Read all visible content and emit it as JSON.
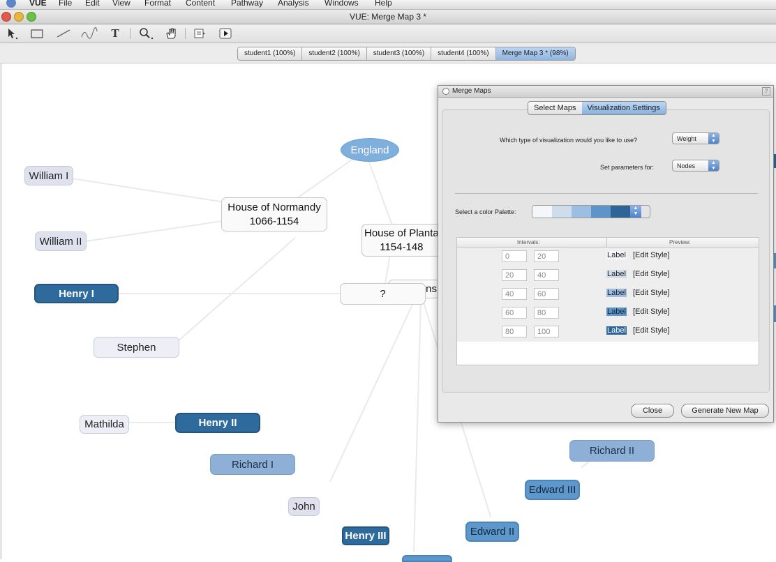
{
  "menubar": {
    "app": "VUE",
    "items": [
      "File",
      "Edit",
      "View",
      "Format",
      "Content",
      "Pathway",
      "Analysis",
      "Windows",
      "Help"
    ]
  },
  "window": {
    "title": "VUE: Merge Map 3 *"
  },
  "toolbar": {
    "tools": [
      "select-tool",
      "rectangle-tool",
      "link-tool",
      "curve-tool",
      "text-tool",
      "zoom-tool",
      "hand-tool",
      "slide-tool",
      "presentation-tool"
    ],
    "text_tool": "T"
  },
  "doc_tabs": [
    {
      "label": "student1 (100%)"
    },
    {
      "label": "student2 (100%)"
    },
    {
      "label": "student3 (100%)"
    },
    {
      "label": "student4 (100%)"
    },
    {
      "label": "Merge Map 3 * (98%)",
      "active": true
    }
  ],
  "map": {
    "nodes": [
      {
        "label": "England",
        "style": "oval"
      },
      {
        "label": "William I",
        "style": "lav"
      },
      {
        "label": "House of Normandy\n1066-1154",
        "style": "white"
      },
      {
        "label": "House of Planta\n1154-148",
        "style": "white"
      },
      {
        "label": "William II",
        "style": "lav"
      },
      {
        "label": "Henry I",
        "style": "dark"
      },
      {
        "label": "ns",
        "style": "white"
      },
      {
        "label": "?",
        "style": "white"
      },
      {
        "label": "Stephen",
        "style": "light"
      },
      {
        "label": "Mathilda",
        "style": "light"
      },
      {
        "label": "Henry II",
        "style": "dark"
      },
      {
        "label": "Richard I",
        "style": "mid"
      },
      {
        "label": "John",
        "style": "lav"
      },
      {
        "label": "Henry III",
        "style": "dark"
      },
      {
        "label": "Richard II",
        "style": "mid"
      },
      {
        "label": "Edward III",
        "style": "blue"
      },
      {
        "label": "Edward II",
        "style": "blue"
      }
    ]
  },
  "dialog": {
    "title": "Merge Maps",
    "help": "?",
    "tabs": [
      {
        "label": "Select Maps"
      },
      {
        "label": "Visualization Settings",
        "active": true
      }
    ],
    "viz_type_label": "Which type of visualization would you like to use?",
    "viz_type_value": "Weight",
    "params_label": "Set parameters for:",
    "params_value": "Nodes",
    "palette_label": "Select a color Palette:",
    "palette_colors": [
      "#f4f6fa",
      "#cfdcec",
      "#9dbde2",
      "#5f94c9",
      "#2e6596"
    ],
    "table_headers": {
      "intervals": "Intervals:",
      "preview": "Preview:"
    },
    "intervals": [
      {
        "from": "0",
        "to": "20",
        "preview": "Label",
        "color": "#f4f6fa",
        "fg": "#222222"
      },
      {
        "from": "20",
        "to": "40",
        "preview": "Label",
        "color": "#cfdcec",
        "fg": "#222222"
      },
      {
        "from": "40",
        "to": "60",
        "preview": "Label",
        "color": "#9dbde2",
        "fg": "#222222"
      },
      {
        "from": "60",
        "to": "80",
        "preview": "Label",
        "color": "#5f94c9",
        "fg": "#10243a"
      },
      {
        "from": "80",
        "to": "100",
        "preview": "Label",
        "color": "#2e6596",
        "fg": "#ffffff"
      }
    ],
    "edit_style": "[Edit Style]",
    "close_button": "Close",
    "generate_button": "Generate New Map"
  }
}
